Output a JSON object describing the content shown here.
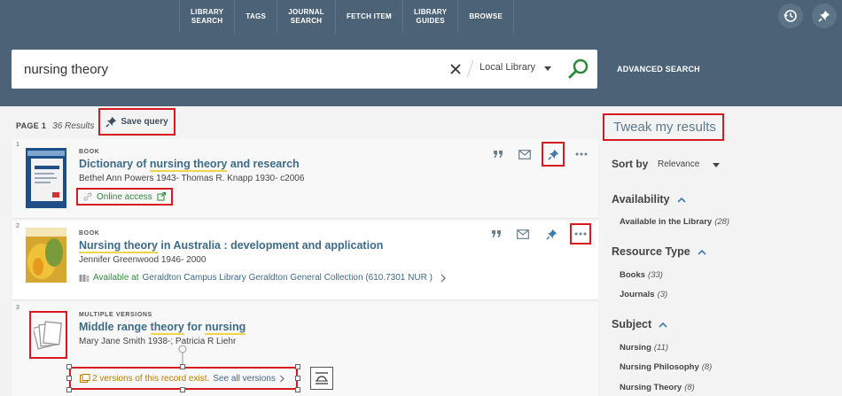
{
  "nav": {
    "items": [
      "LIBRARY\nSEARCH",
      "TAGS",
      "JOURNAL\nSEARCH",
      "FETCH ITEM",
      "LIBRARY\nGUIDES",
      "BROWSE"
    ]
  },
  "search": {
    "query": "nursing theory",
    "scope": "Local Library",
    "advanced": "ADVANCED SEARCH"
  },
  "results_header": {
    "page": "PAGE 1",
    "count": "36 Results",
    "save_query": "Save query"
  },
  "results": [
    {
      "num": "1",
      "type": "BOOK",
      "title_parts": [
        "Dictionary of ",
        "nursing theory",
        " and research"
      ],
      "author": "Bethel Ann Powers 1943- Thomas R. Knapp 1930- c2006",
      "access": "Online access"
    },
    {
      "num": "2",
      "type": "BOOK",
      "title_parts": [
        "Nursing theory",
        " in Australia : development and application"
      ],
      "author": "Jennifer Greenwood 1946- 2000",
      "avail_label": "Available at",
      "avail_location": "Geraldton Campus Library  Geraldton General Collection (610.7301 NUR )"
    },
    {
      "num": "3",
      "type": "MULTIPLE VERSIONS",
      "title_parts": [
        "Middle range ",
        "theory",
        " for ",
        "nursing"
      ],
      "author": "Mary Jane Smith 1938-; Patricia R Liehr",
      "versions_text": "2 versions of this record exist.",
      "versions_link": "See all versions"
    }
  ],
  "facets": {
    "title": "Tweak my results",
    "sort_label": "Sort by",
    "sort_value": "Relevance",
    "groups": [
      {
        "label": "Availability",
        "items": [
          {
            "label": "Available in the Library",
            "count": "(28)"
          }
        ]
      },
      {
        "label": "Resource Type",
        "items": [
          {
            "label": "Books",
            "count": "(33)"
          },
          {
            "label": "Journals",
            "count": "(3)"
          }
        ]
      },
      {
        "label": "Subject",
        "items": [
          {
            "label": "Nursing",
            "count": "(11)"
          },
          {
            "label": "Nursing Philosophy",
            "count": "(8)"
          },
          {
            "label": "Nursing Theory",
            "count": "(8)"
          }
        ]
      }
    ]
  },
  "colors": {
    "header": "#4c6377",
    "accent_red": "#d71920",
    "link": "#3d6b8a",
    "available": "#2d8a3a",
    "highlight": "#f0d548"
  },
  "icons": [
    "history-icon",
    "pin-icon",
    "clear-icon",
    "search-icon",
    "citation-icon",
    "email-icon",
    "more-icon",
    "external-link-icon",
    "link-icon",
    "book-location-icon",
    "versions-icon",
    "chevron-up-icon",
    "caret-down-icon"
  ]
}
